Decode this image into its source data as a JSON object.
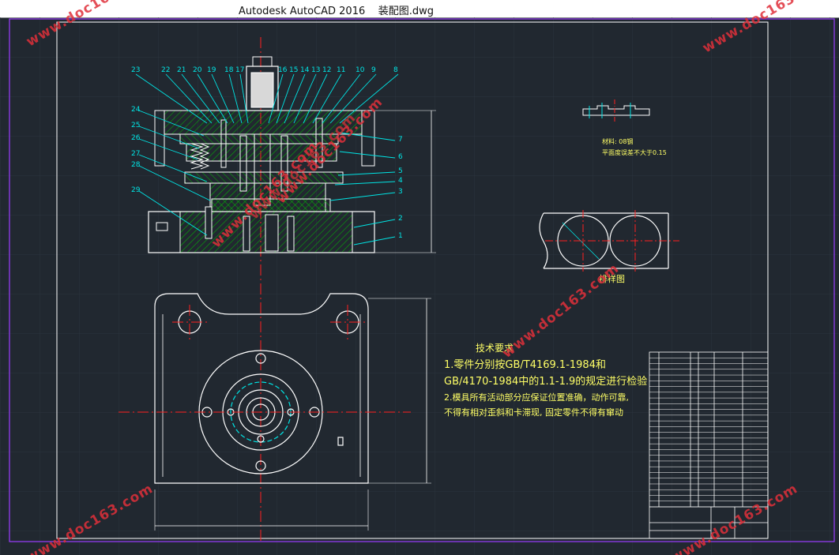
{
  "window": {
    "title": "Autodesk AutoCAD 2016",
    "filename": "装配图.dwg"
  },
  "colors": {
    "background": "#212830",
    "grid": "#2a323c",
    "geometry": "#ffffff",
    "leaders": "#00e5e5",
    "centerline": "#ff2020",
    "hatch": "#00c000",
    "notes": "#ffff66",
    "watermark": "#e0303a",
    "frame": "#a040ff"
  },
  "watermarks": [
    "www.doc163.com",
    "www.doc163.com",
    "www.doc163.com",
    "www.doc163.com",
    "www.doc163.com",
    "www.doc163.com",
    "www.doc163.com",
    "www.doc163.com"
  ],
  "part_labels": {
    "top_row": [
      "23",
      "22",
      "21",
      "20",
      "19",
      "18",
      "17",
      "16",
      "15",
      "14",
      "13",
      "12",
      "11",
      "10",
      "9",
      "8"
    ],
    "left_column": [
      "24",
      "25",
      "26",
      "27",
      "28",
      "29"
    ],
    "right_column": [
      "7",
      "6",
      "5",
      "4",
      "3",
      "2",
      "1"
    ]
  },
  "part_detail": {
    "material_note": "材料: 08钢",
    "flatness_note": "平面度误差不大于0.15"
  },
  "strip_layout_label": "排样图",
  "tech_notes": {
    "heading": "技术要求",
    "line1": "1.零件分别按GB/T4169.1-1984和",
    "line2": "GB/4170-1984中的1.1-1.9的规定进行检验",
    "line3": "2.模具所有活动部分应保证位置准确，动作可靠,",
    "line4": "不得有相对歪斜和卡滞现, 固定零件不得有窜动"
  }
}
